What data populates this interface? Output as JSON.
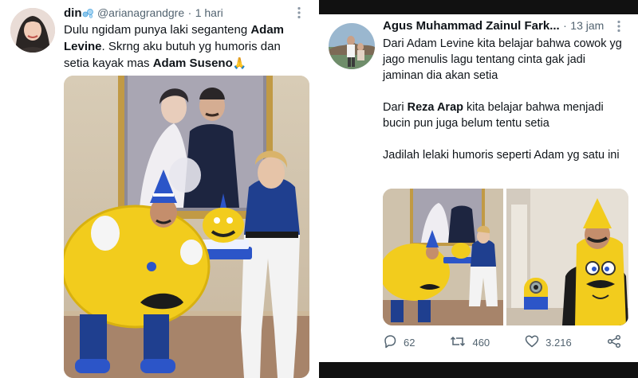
{
  "left_tweet": {
    "display_name": "din",
    "handle": "@arianagrandgre",
    "separator": "·",
    "time": "1 hari",
    "text": {
      "p1": "Dulu ngidam punya laki seganteng ",
      "b1": "Adam Levine",
      "p2": ". Skrng aku butuh yg humoris dan setia kayak mas ",
      "b2": "Adam Suseno",
      "emoji": "🙏"
    },
    "icons": {
      "badge": "bubbles-badge-icon",
      "more": "more-dots-icon",
      "emoji": "praying-hands-emoji"
    }
  },
  "right_tweet": {
    "display_name": "Agus Muhammad Zainul Fark...",
    "separator": "·",
    "time": "13 jam",
    "text": {
      "line1": "Dari Adam Levine kita belajar bahwa cowok yg jago menulis lagu tentang cinta gak jadi jaminan dia akan setia",
      "p2a": "Dari ",
      "b2": "Reza Arap",
      "p2b": " kita belajar bahwa menjadi bucin pun juga belum tentu setia",
      "line3": "Jadilah lelaki humoris seperti Adam yg satu ini"
    },
    "actions": {
      "replies": "62",
      "retweets": "460",
      "likes": "3.216"
    },
    "icons": {
      "reply": "reply-icon",
      "retweet": "retweet-icon",
      "like": "heart-icon",
      "share": "share-icon",
      "more": "more-dots-icon"
    }
  },
  "colors": {
    "text": "#0f1419",
    "muted": "#536471",
    "bars": "#111111",
    "mascot_yellow": "#f2cc1d",
    "jacket_blue": "#1f3f8f"
  }
}
